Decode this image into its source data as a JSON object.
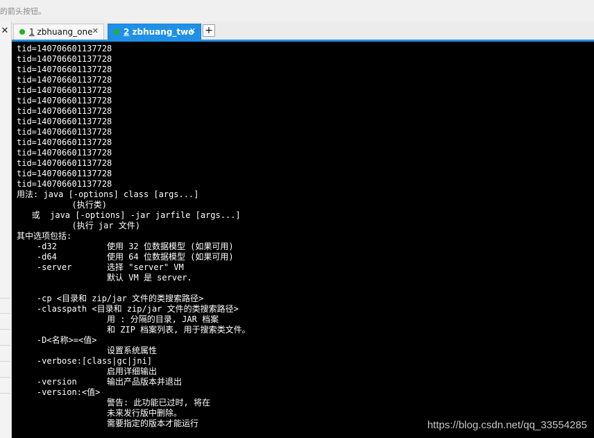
{
  "hint": {
    "text": "的箭头按钮。"
  },
  "left_panel": {
    "close_glyph": "✕"
  },
  "tabs": [
    {
      "number": "1",
      "title": "zbhuang_one",
      "status_color": "#22b422",
      "close_glyph": "✕",
      "active": false
    },
    {
      "number": "2",
      "title": "zbhuang_two",
      "status_color": "#22b422",
      "close_glyph": "✕",
      "active": true
    }
  ],
  "tab_add": {
    "label": "+"
  },
  "colors": {
    "accent": "#1e90e8",
    "terminal_bg": "#000000",
    "terminal_fg": "#ffffff",
    "status_dot": "#22b422"
  },
  "terminal": {
    "lines": [
      "tid=140706601137728",
      "tid=140706601137728",
      "tid=140706601137728",
      "tid=140706601137728",
      "tid=140706601137728",
      "tid=140706601137728",
      "tid=140706601137728",
      "tid=140706601137728",
      "tid=140706601137728",
      "tid=140706601137728",
      "tid=140706601137728",
      "tid=140706601137728",
      "tid=140706601137728",
      "tid=140706601137728",
      "用法: java [-options] class [args...]",
      "           (执行类)",
      "   或  java [-options] -jar jarfile [args...]",
      "           (执行 jar 文件)",
      "其中选项包括:",
      "    -d32          使用 32 位数据模型 (如果可用)",
      "    -d64          使用 64 位数据模型 (如果可用)",
      "    -server       选择 \"server\" VM",
      "                  默认 VM 是 server.",
      "",
      "    -cp <目录和 zip/jar 文件的类搜索路径>",
      "    -classpath <目录和 zip/jar 文件的类搜索路径>",
      "                  用 : 分隔的目录, JAR 档案",
      "                  和 ZIP 档案列表, 用于搜索类文件。",
      "    -D<名称>=<值>",
      "                  设置系统属性",
      "    -verbose:[class|gc|jni]",
      "                  启用详细输出",
      "    -version      输出产品版本并退出",
      "    -version:<值>",
      "                  警告: 此功能已过时, 将在",
      "                  未来发行版中删除。",
      "                  需要指定的版本才能运行"
    ]
  },
  "watermark": {
    "text": "https://blog.csdn.net/qq_33554285"
  }
}
